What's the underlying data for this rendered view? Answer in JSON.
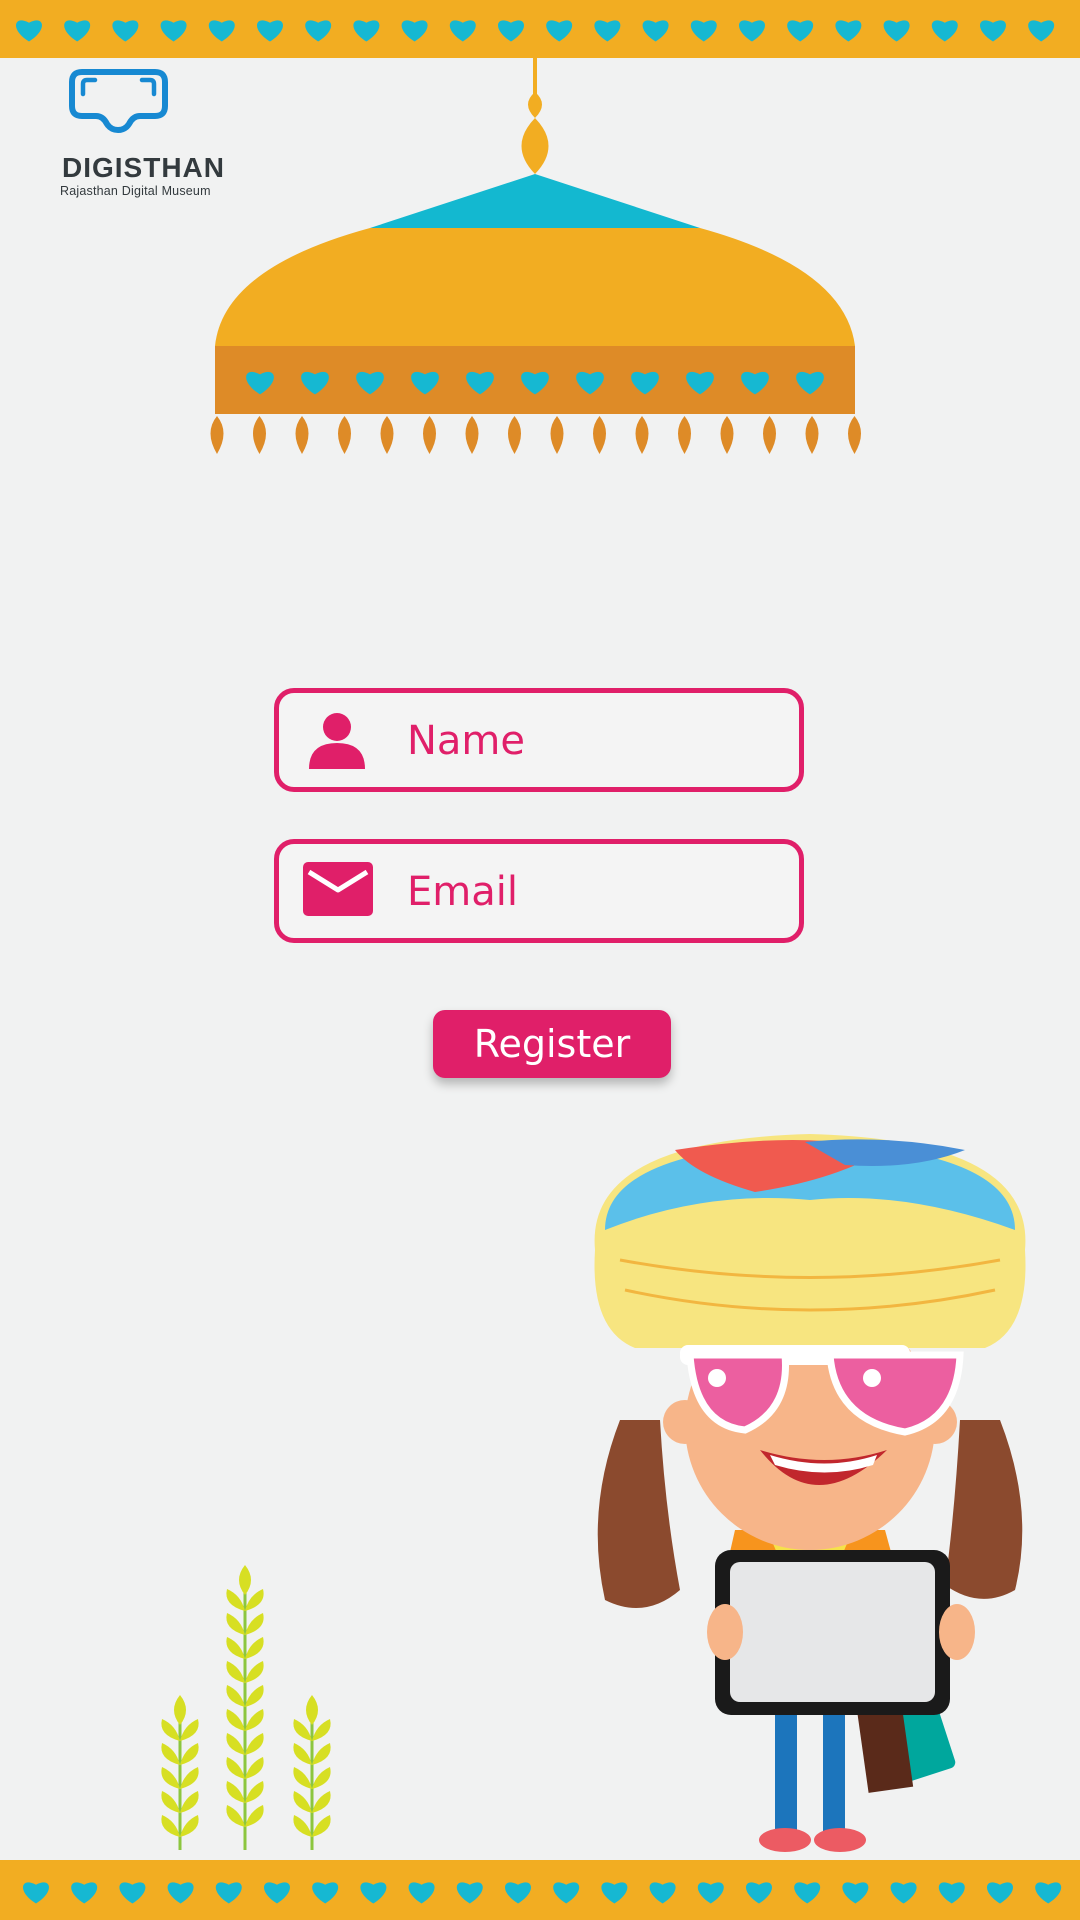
{
  "brand": {
    "name": "DIGISTHAN",
    "tagline": "Rajasthan Digital Museum",
    "logo_icon": "vr-headset-icon"
  },
  "form": {
    "name_placeholder": "Name",
    "email_placeholder": "Email",
    "name_icon": "user-icon",
    "email_icon": "envelope-icon",
    "register_label": "Register"
  },
  "colors": {
    "accent": "#e01f69",
    "band": "#f2ad22",
    "heart": "#16b8d2",
    "background": "#f1f2f2"
  },
  "decor": {
    "top_band_icon": "heart-icon",
    "bottom_band_icon": "heart-icon",
    "canopy_icon": "umbrella-canopy-icon",
    "wheat_icon": "wheat-plants-icon",
    "mascot_icon": "girl-with-turban-holding-tablet-icon"
  }
}
